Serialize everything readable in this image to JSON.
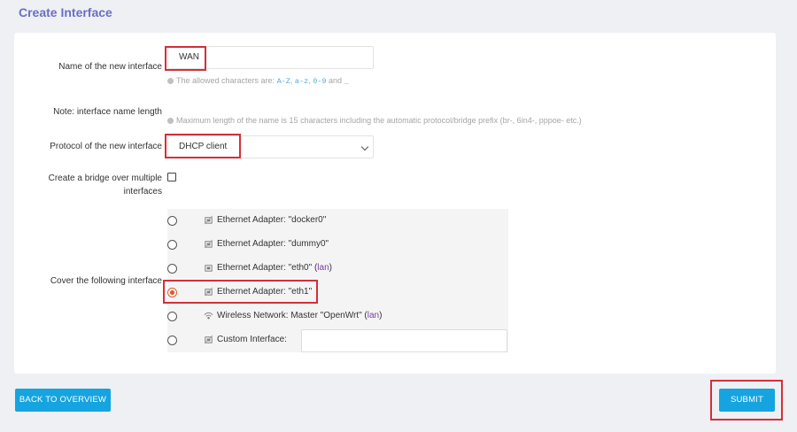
{
  "page_title": "Create Interface",
  "name_field": {
    "label": "Name of the new interface",
    "value": "WAN",
    "hint_prefix": "The allowed characters are: ",
    "hint_code1": "A-Z",
    "hint_sep1": ", ",
    "hint_code2": "a-z",
    "hint_sep2": ", ",
    "hint_code3": "0-9",
    "hint_and": " and ",
    "hint_code4": "_"
  },
  "name_length": {
    "label": "Note: interface name length",
    "hint": "Maximum length of the name is 15 characters including the automatic protocol/bridge prefix (br-, 6in4-, pppoe- etc.)"
  },
  "protocol": {
    "label": "Protocol of the new interface",
    "selected": "DHCP client"
  },
  "bridge": {
    "label_line1": "Create a bridge over multiple",
    "label_line2": "interfaces",
    "checked": false
  },
  "cover": {
    "label": "Cover the following interface",
    "selected_index": 3,
    "interfaces": [
      {
        "text": "Ethernet Adapter: \"docker0\"",
        "network": "",
        "icon": "ethernet-port-icon"
      },
      {
        "text": "Ethernet Adapter: \"dummy0\"",
        "network": "",
        "icon": "ethernet-port-icon"
      },
      {
        "text": "Ethernet Adapter: \"eth0\"",
        "network": "lan",
        "icon": "ethernet-port-icon"
      },
      {
        "text": "Ethernet Adapter: \"eth1\"",
        "network": "",
        "icon": "ethernet-port-icon"
      },
      {
        "text": "Wireless Network: Master \"OpenWrt\"",
        "network": "lan",
        "icon": "wifi-icon"
      },
      {
        "text": "Custom Interface:",
        "network": "",
        "icon": "ethernet-port-icon"
      }
    ],
    "custom_value": ""
  },
  "buttons": {
    "back": "BACK TO OVERVIEW",
    "submit": "SUBMIT"
  },
  "colors": {
    "accent": "#15a4e0",
    "title": "#6a6fc6",
    "highlight": "#d42f39",
    "radio_checked": "#e0582a",
    "network_link": "#7a3ca2"
  }
}
